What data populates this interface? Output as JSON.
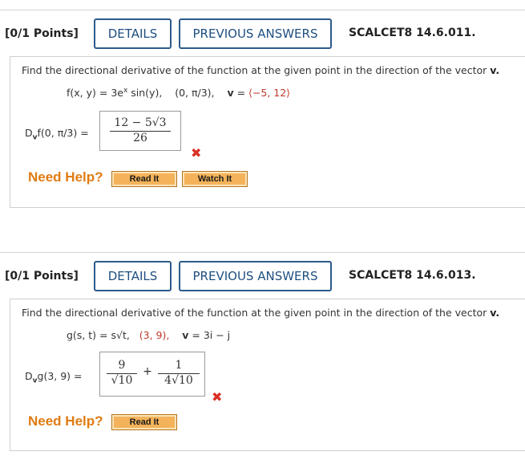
{
  "q1": {
    "points": "[0/1 Points]",
    "details_label": "DETAILS",
    "previous_answers_label": "PREVIOUS ANSWERS",
    "code": "SCALCET8 14.6.011.",
    "prompt": "Find the directional derivative of the function at the given point in the direction of the vector",
    "prompt_vec": "v.",
    "function": "f(x, y) = 3e",
    "function_exp": "x",
    "function_rest": " sin(y),",
    "point": "(0, π/3),",
    "vector_label": "v",
    "vector_eq": " = ",
    "vector_value": "⟨−5, 12⟩",
    "answer_label_pre": "D",
    "answer_label_sub": "v",
    "answer_label_post": "f(0, π/3) =",
    "answer_numerator": "12 − 5√3",
    "answer_denominator": "26",
    "need_help": "Need Help?",
    "read_it": "Read It",
    "watch_it": "Watch It"
  },
  "q2": {
    "points": "[0/1 Points]",
    "details_label": "DETAILS",
    "previous_answers_label": "PREVIOUS ANSWERS",
    "code": "SCALCET8 14.6.013.",
    "prompt": "Find the directional derivative of the function at the given point in the direction of the vector",
    "prompt_vec": "v.",
    "function": "g(s, t) = s√t,",
    "point": "(3, 9),",
    "vector_label": "v",
    "vector_value": " = 3i − j",
    "answer_label_pre": "D",
    "answer_label_sub": "v",
    "answer_label_post": "g(3, 9) =",
    "term1_num": "9",
    "term1_den": "√10",
    "plus": "+",
    "term2_num": "1",
    "term2_den": "4√10",
    "need_help": "Need Help?",
    "read_it": "Read It"
  },
  "icons": {
    "incorrect": "x-mark-icon"
  },
  "colors": {
    "button_border": "#2c5a8a",
    "need_help": "#e07b12",
    "incorrect": "#d93025",
    "help_button": "#f4b35a"
  }
}
